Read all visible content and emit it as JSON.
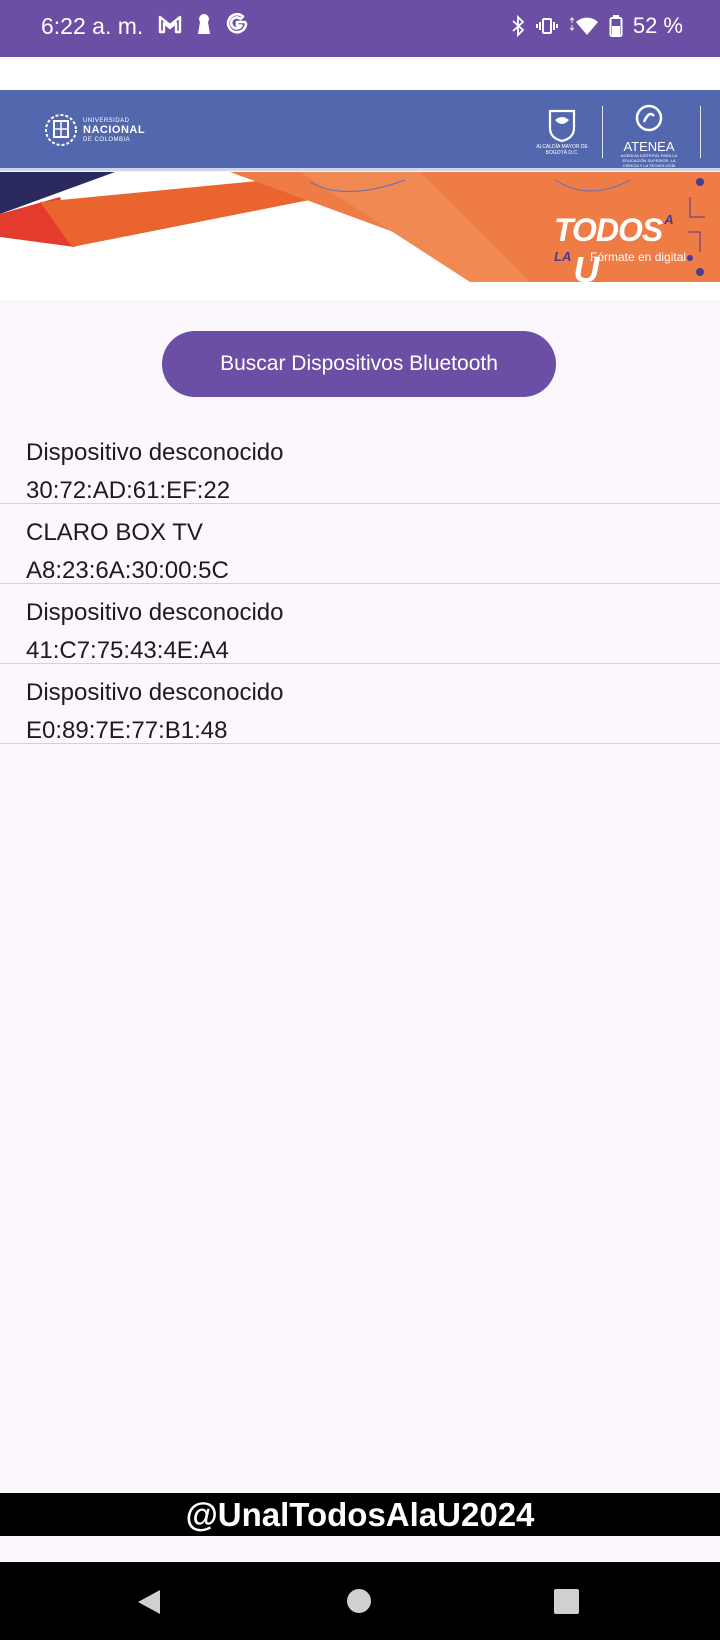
{
  "status_bar": {
    "time": "6:22 a. m.",
    "notifications": [
      "gmail-icon",
      "keyhole-icon",
      "google-icon"
    ],
    "battery": "52 %"
  },
  "banner": {
    "unal": {
      "line1": "UNIVERSIDAD",
      "line2": "NACIONAL",
      "line3": "DE COLOMBIA"
    },
    "alcaldia": "ALCALDÍA MAYOR DE BOGOTÁ D.C.",
    "atenea": {
      "title": "ATENEA",
      "subtitle": "AGENCIA DISTRITAL PARA LA EDUCACIÓN SUPERIOR, LA CIENCIA Y LA TECNOLOGÍA"
    },
    "todos": {
      "word": "TODOS",
      "ala": "A LA",
      "u": "U",
      "tagline": "Fórmate en digital"
    }
  },
  "main": {
    "search_button": "Buscar Dispositivos Bluetooth",
    "devices": [
      {
        "name": "Dispositivo desconocido",
        "mac": "30:72:AD:61:EF:22"
      },
      {
        "name": "CLARO BOX TV",
        "mac": "A8:23:6A:30:00:5C"
      },
      {
        "name": "Dispositivo desconocido",
        "mac": "41:C7:75:43:4E:A4"
      },
      {
        "name": "Dispositivo desconocido",
        "mac": "E0:89:7E:77:B1:48"
      }
    ]
  },
  "footer": {
    "handle": "@UnalTodosAlaU2024"
  },
  "colors": {
    "accent": "#6a4fa5",
    "banner_blue": "#5267ad",
    "banner_orange": "#e9642e",
    "background": "#fcf6fd"
  }
}
